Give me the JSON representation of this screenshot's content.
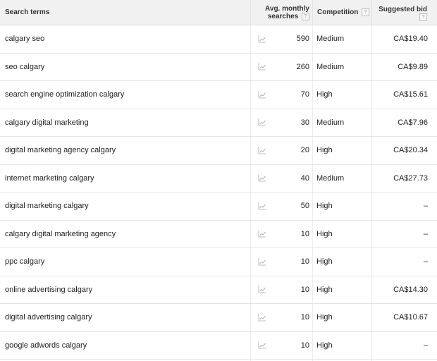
{
  "headers": {
    "term": "Search terms",
    "avg_line1": "Avg. monthly",
    "avg_line2": "searches",
    "competition": "Competition",
    "bid": "Suggested bid",
    "help": "?"
  },
  "rows": [
    {
      "term": "calgary seo",
      "avg": "590",
      "competition": "Medium",
      "bid": "CA$19.40"
    },
    {
      "term": "seo calgary",
      "avg": "260",
      "competition": "Medium",
      "bid": "CA$9.89"
    },
    {
      "term": "search engine optimization calgary",
      "avg": "70",
      "competition": "High",
      "bid": "CA$15.61"
    },
    {
      "term": "calgary digital marketing",
      "avg": "30",
      "competition": "Medium",
      "bid": "CA$7.96"
    },
    {
      "term": "digital marketing agency calgary",
      "avg": "20",
      "competition": "High",
      "bid": "CA$20.34"
    },
    {
      "term": "internet marketing calgary",
      "avg": "40",
      "competition": "Medium",
      "bid": "CA$27.73"
    },
    {
      "term": "digital marketing calgary",
      "avg": "50",
      "competition": "High",
      "bid": "–"
    },
    {
      "term": "calgary digital marketing agency",
      "avg": "10",
      "competition": "High",
      "bid": "–"
    },
    {
      "term": "ppc calgary",
      "avg": "10",
      "competition": "High",
      "bid": "–"
    },
    {
      "term": "online advertising calgary",
      "avg": "10",
      "competition": "High",
      "bid": "CA$14.30"
    },
    {
      "term": "digital advertising calgary",
      "avg": "10",
      "competition": "High",
      "bid": "CA$10.67"
    },
    {
      "term": "google adwords calgary",
      "avg": "10",
      "competition": "High",
      "bid": "–"
    }
  ]
}
